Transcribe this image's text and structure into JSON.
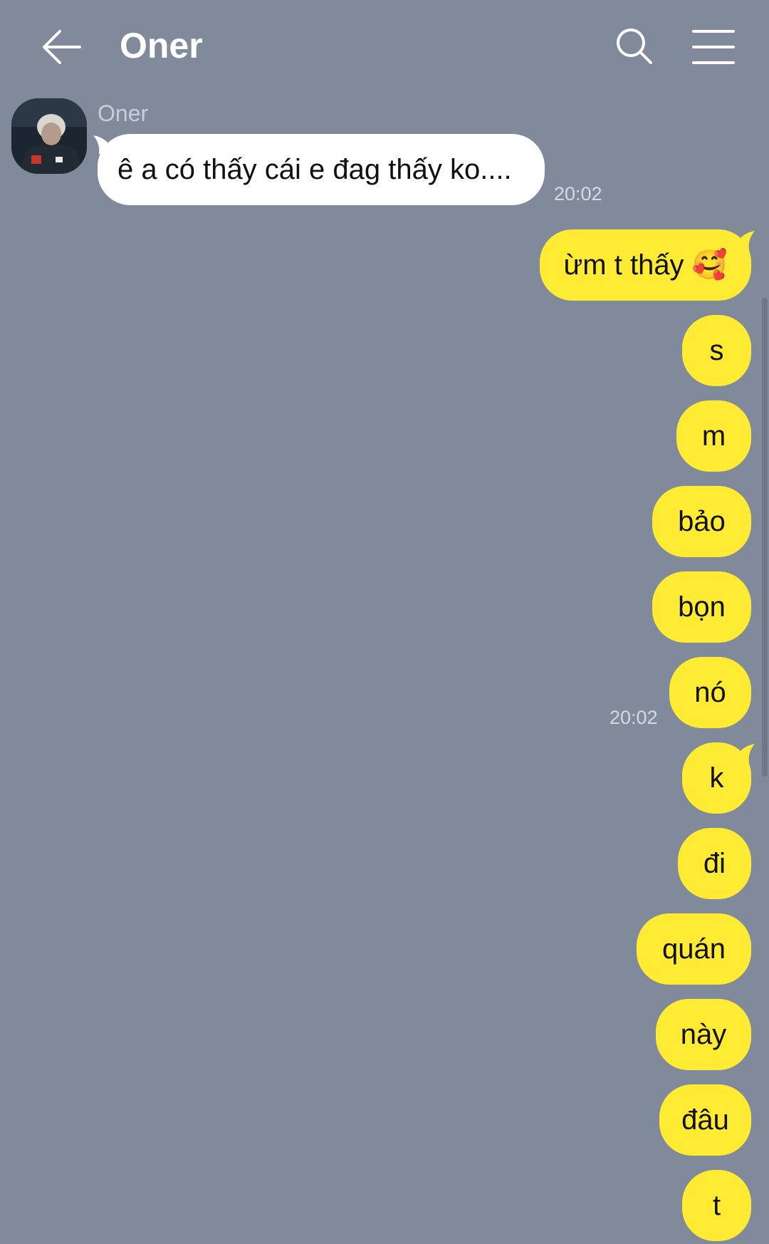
{
  "header": {
    "title": "Oner"
  },
  "icons": {
    "back": "arrow-left-icon",
    "search": "search-icon",
    "menu": "hamburger-menu-icon"
  },
  "colors": {
    "background": "#808a9b",
    "outgoing": "#ffeb33",
    "incoming": "#ffffff"
  },
  "incoming": {
    "sender": "Oner",
    "message": "ê a có thấy cái e đag thấy ko....",
    "time": "20:02"
  },
  "outgoing": {
    "messages": [
      "ừm t thấy 🥰",
      "s",
      "m",
      "bảo",
      "bọn",
      "nó",
      "k",
      "đi",
      "quán",
      "này",
      "đâu",
      "t"
    ],
    "time": "20:02"
  }
}
